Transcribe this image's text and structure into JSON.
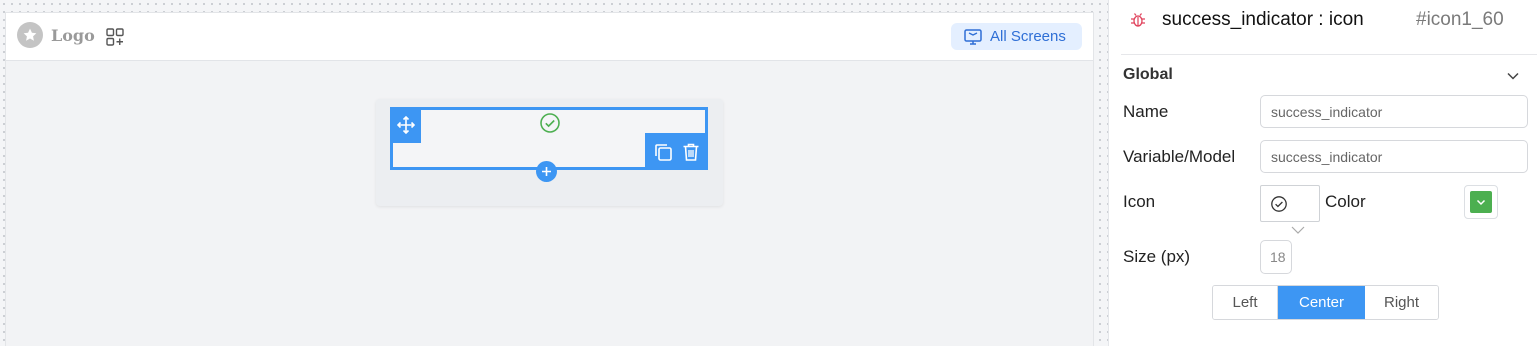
{
  "canvas": {
    "logo_text": "Logo",
    "screens_button_label": "All Screens"
  },
  "panel": {
    "component_name": "success_indicator : icon",
    "component_id": "#icon1_60",
    "section_title": "Global",
    "fields": {
      "name_label": "Name",
      "name_value": "success_indicator",
      "variable_label": "Variable/Model",
      "variable_value": "success_indicator",
      "icon_label": "Icon",
      "icon_value": "check-circle-icon",
      "color_label": "Color",
      "color_value": "#4caf50",
      "size_label": "Size (px)",
      "size_value": "18"
    },
    "alignment": {
      "options": [
        "Left",
        "Center",
        "Right"
      ],
      "selected": "Center"
    }
  },
  "colors": {
    "accent": "#3d96f3",
    "success": "#4caf50",
    "screens_button_bg": "#e4efff"
  }
}
